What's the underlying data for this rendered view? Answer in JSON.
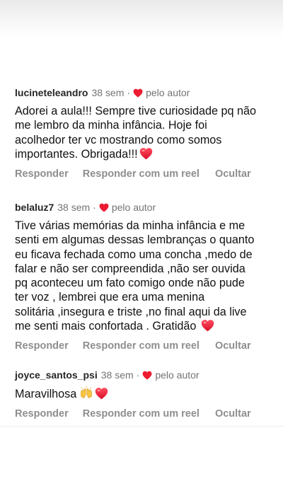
{
  "comments": [
    {
      "username": "lucineteleandro",
      "time": "38 sem",
      "separator": "·",
      "liked_by_author": "pelo autor",
      "text": "Adorei a aula!!! Sempre tive curiosidade pq não\nme lembro da minha infância. Hoje foi\nacolhedor ter vc mostrando como somos\nimportantes. Obrigada!!!",
      "trailing_emoji": "red-heart-emoji",
      "actions": {
        "reply": "Responder",
        "reply_reel": "Responder com um reel",
        "hide": "Ocultar"
      }
    },
    {
      "username": "belaluz7",
      "time": "38 sem",
      "separator": "·",
      "liked_by_author": "pelo autor",
      "text": "Tive várias memórias da minha infância e me\nsenti em algumas dessas lembranças o quanto\neu ficava fechada como uma concha ,medo de\nfalar e não ser compreendida ,não ser ouvida\npq aconteceu um  fato comigo onde não pude\nter voz , lembrei que era uma menina\nsolitária ,insegura e triste ,no final aqui da live\nme senti mais confortada . Gratidão ",
      "trailing_emoji": "red-heart-emoji",
      "actions": {
        "reply": "Responder",
        "reply_reel": "Responder com um reel",
        "hide": "Ocultar"
      }
    },
    {
      "username": "joyce_santos_psi",
      "time": "38 sem",
      "separator": "·",
      "liked_by_author": "pelo autor",
      "text": "Maravilhosa",
      "trailing_emoji": "raising-hands-and-red-heart-emoji",
      "actions": {
        "reply": "Responder",
        "reply_reel": "Responder com um reel",
        "hide": "Ocultar"
      }
    }
  ],
  "colors": {
    "username": "#262626",
    "secondary": "#737373",
    "action": "#8e8e8e",
    "heart": "#ed1b30"
  }
}
